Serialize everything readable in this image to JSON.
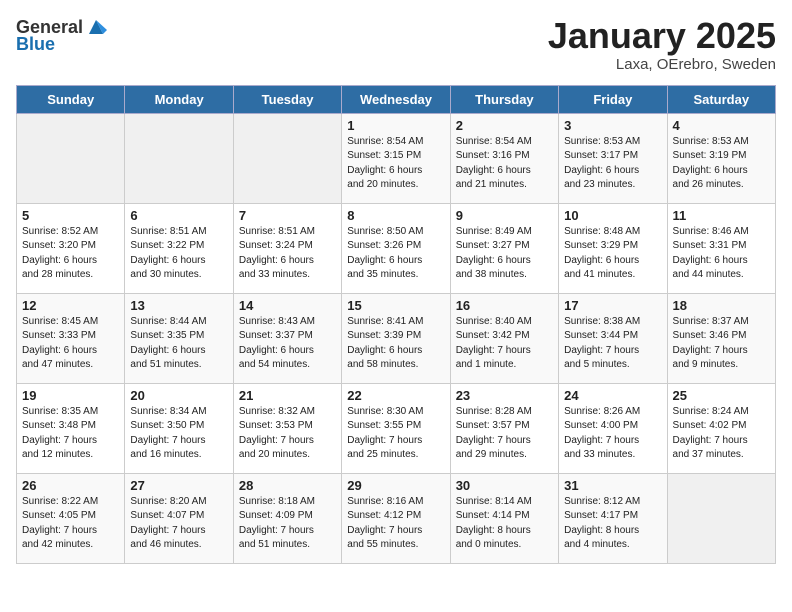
{
  "header": {
    "logo_general": "General",
    "logo_blue": "Blue",
    "title": "January 2025",
    "subtitle": "Laxa, OErebro, Sweden"
  },
  "days_of_week": [
    "Sunday",
    "Monday",
    "Tuesday",
    "Wednesday",
    "Thursday",
    "Friday",
    "Saturday"
  ],
  "weeks": [
    [
      {
        "day": "",
        "info": ""
      },
      {
        "day": "",
        "info": ""
      },
      {
        "day": "",
        "info": ""
      },
      {
        "day": "1",
        "info": "Sunrise: 8:54 AM\nSunset: 3:15 PM\nDaylight: 6 hours\nand 20 minutes."
      },
      {
        "day": "2",
        "info": "Sunrise: 8:54 AM\nSunset: 3:16 PM\nDaylight: 6 hours\nand 21 minutes."
      },
      {
        "day": "3",
        "info": "Sunrise: 8:53 AM\nSunset: 3:17 PM\nDaylight: 6 hours\nand 23 minutes."
      },
      {
        "day": "4",
        "info": "Sunrise: 8:53 AM\nSunset: 3:19 PM\nDaylight: 6 hours\nand 26 minutes."
      }
    ],
    [
      {
        "day": "5",
        "info": "Sunrise: 8:52 AM\nSunset: 3:20 PM\nDaylight: 6 hours\nand 28 minutes."
      },
      {
        "day": "6",
        "info": "Sunrise: 8:51 AM\nSunset: 3:22 PM\nDaylight: 6 hours\nand 30 minutes."
      },
      {
        "day": "7",
        "info": "Sunrise: 8:51 AM\nSunset: 3:24 PM\nDaylight: 6 hours\nand 33 minutes."
      },
      {
        "day": "8",
        "info": "Sunrise: 8:50 AM\nSunset: 3:26 PM\nDaylight: 6 hours\nand 35 minutes."
      },
      {
        "day": "9",
        "info": "Sunrise: 8:49 AM\nSunset: 3:27 PM\nDaylight: 6 hours\nand 38 minutes."
      },
      {
        "day": "10",
        "info": "Sunrise: 8:48 AM\nSunset: 3:29 PM\nDaylight: 6 hours\nand 41 minutes."
      },
      {
        "day": "11",
        "info": "Sunrise: 8:46 AM\nSunset: 3:31 PM\nDaylight: 6 hours\nand 44 minutes."
      }
    ],
    [
      {
        "day": "12",
        "info": "Sunrise: 8:45 AM\nSunset: 3:33 PM\nDaylight: 6 hours\nand 47 minutes."
      },
      {
        "day": "13",
        "info": "Sunrise: 8:44 AM\nSunset: 3:35 PM\nDaylight: 6 hours\nand 51 minutes."
      },
      {
        "day": "14",
        "info": "Sunrise: 8:43 AM\nSunset: 3:37 PM\nDaylight: 6 hours\nand 54 minutes."
      },
      {
        "day": "15",
        "info": "Sunrise: 8:41 AM\nSunset: 3:39 PM\nDaylight: 6 hours\nand 58 minutes."
      },
      {
        "day": "16",
        "info": "Sunrise: 8:40 AM\nSunset: 3:42 PM\nDaylight: 7 hours\nand 1 minute."
      },
      {
        "day": "17",
        "info": "Sunrise: 8:38 AM\nSunset: 3:44 PM\nDaylight: 7 hours\nand 5 minutes."
      },
      {
        "day": "18",
        "info": "Sunrise: 8:37 AM\nSunset: 3:46 PM\nDaylight: 7 hours\nand 9 minutes."
      }
    ],
    [
      {
        "day": "19",
        "info": "Sunrise: 8:35 AM\nSunset: 3:48 PM\nDaylight: 7 hours\nand 12 minutes."
      },
      {
        "day": "20",
        "info": "Sunrise: 8:34 AM\nSunset: 3:50 PM\nDaylight: 7 hours\nand 16 minutes."
      },
      {
        "day": "21",
        "info": "Sunrise: 8:32 AM\nSunset: 3:53 PM\nDaylight: 7 hours\nand 20 minutes."
      },
      {
        "day": "22",
        "info": "Sunrise: 8:30 AM\nSunset: 3:55 PM\nDaylight: 7 hours\nand 25 minutes."
      },
      {
        "day": "23",
        "info": "Sunrise: 8:28 AM\nSunset: 3:57 PM\nDaylight: 7 hours\nand 29 minutes."
      },
      {
        "day": "24",
        "info": "Sunrise: 8:26 AM\nSunset: 4:00 PM\nDaylight: 7 hours\nand 33 minutes."
      },
      {
        "day": "25",
        "info": "Sunrise: 8:24 AM\nSunset: 4:02 PM\nDaylight: 7 hours\nand 37 minutes."
      }
    ],
    [
      {
        "day": "26",
        "info": "Sunrise: 8:22 AM\nSunset: 4:05 PM\nDaylight: 7 hours\nand 42 minutes."
      },
      {
        "day": "27",
        "info": "Sunrise: 8:20 AM\nSunset: 4:07 PM\nDaylight: 7 hours\nand 46 minutes."
      },
      {
        "day": "28",
        "info": "Sunrise: 8:18 AM\nSunset: 4:09 PM\nDaylight: 7 hours\nand 51 minutes."
      },
      {
        "day": "29",
        "info": "Sunrise: 8:16 AM\nSunset: 4:12 PM\nDaylight: 7 hours\nand 55 minutes."
      },
      {
        "day": "30",
        "info": "Sunrise: 8:14 AM\nSunset: 4:14 PM\nDaylight: 8 hours\nand 0 minutes."
      },
      {
        "day": "31",
        "info": "Sunrise: 8:12 AM\nSunset: 4:17 PM\nDaylight: 8 hours\nand 4 minutes."
      },
      {
        "day": "",
        "info": ""
      }
    ]
  ]
}
